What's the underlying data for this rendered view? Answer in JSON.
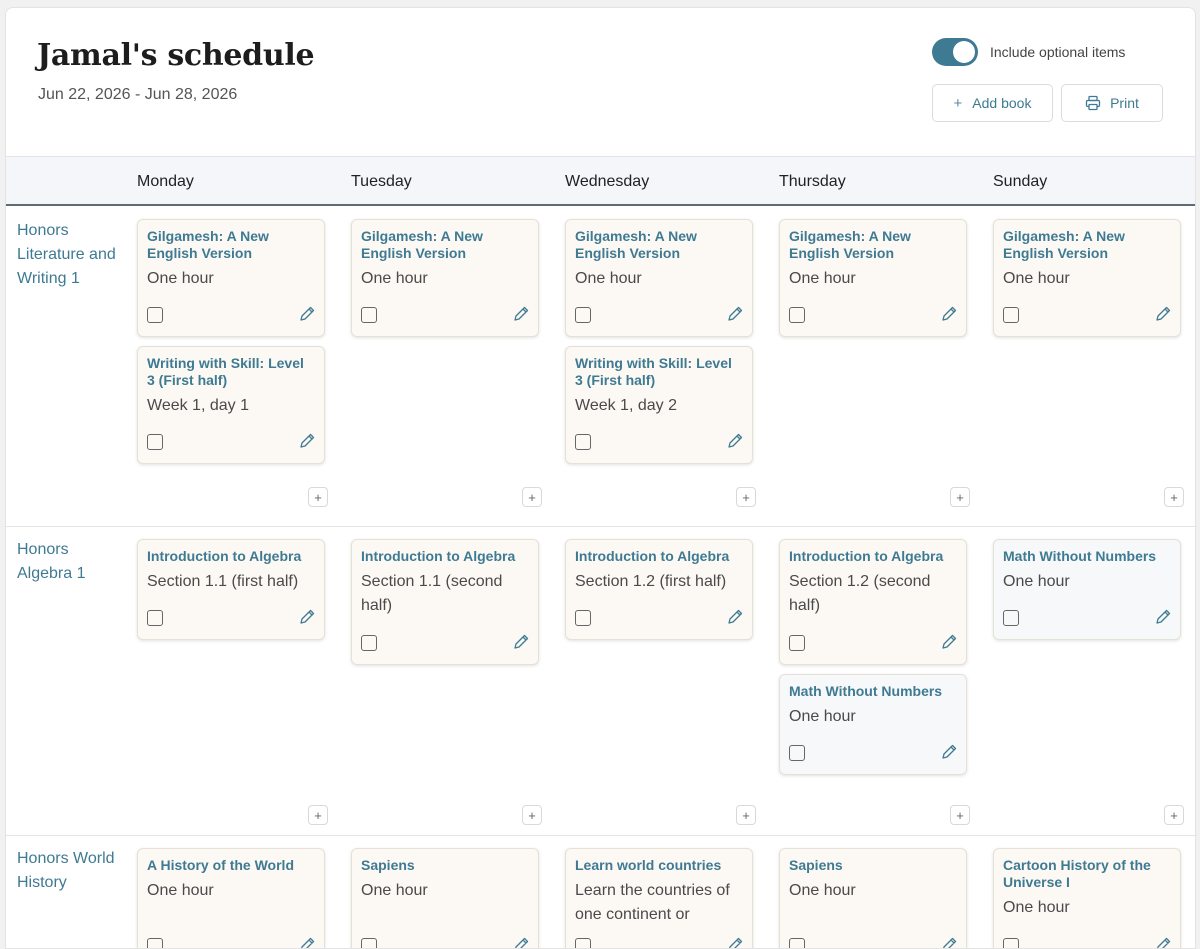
{
  "header": {
    "title": "Jamal's schedule",
    "date_range": "Jun 22, 2026 - Jun 28, 2026",
    "toggle_label": "Include optional items",
    "toggle_on": true,
    "add_book_label": "Add book",
    "print_label": "Print"
  },
  "days": [
    "Monday",
    "Tuesday",
    "Wednesday",
    "Thursday",
    "Sunday"
  ],
  "colors": {
    "accent": "#3f7a93",
    "card_bg": "#fcf9f4",
    "optional_card_bg": "#f7f8f9"
  },
  "rows": [
    {
      "subject": "Honors Literature and Writing 1",
      "cells": [
        [
          {
            "title": "Gilgamesh: A New English Version",
            "desc": "One hour"
          },
          {
            "title": "Writing with Skill: Level 3 (First half)",
            "desc": "Week 1, day 1"
          }
        ],
        [
          {
            "title": "Gilgamesh: A New English Version",
            "desc": "One hour"
          }
        ],
        [
          {
            "title": "Gilgamesh: A New English Version",
            "desc": "One hour"
          },
          {
            "title": "Writing with Skill: Level 3 (First half)",
            "desc": "Week 1, day 2"
          }
        ],
        [
          {
            "title": "Gilgamesh: A New English Version",
            "desc": "One hour"
          }
        ],
        [
          {
            "title": "Gilgamesh: A New English Version",
            "desc": "One hour"
          }
        ]
      ]
    },
    {
      "subject": "Honors Algebra 1",
      "cells": [
        [
          {
            "title": "Introduction to Algebra",
            "desc": "Section 1.1 (first half)"
          }
        ],
        [
          {
            "title": "Introduction to Algebra",
            "desc": "Section 1.1 (second half)"
          }
        ],
        [
          {
            "title": "Introduction to Algebra",
            "desc": "Section 1.2 (first half)"
          }
        ],
        [
          {
            "title": "Introduction to Algebra",
            "desc": "Section 1.2 (second half)"
          },
          {
            "title": "Math Without Numbers",
            "desc": "One hour",
            "optional": true
          }
        ],
        [
          {
            "title": "Math Without Numbers",
            "desc": "One hour",
            "optional": true
          }
        ]
      ]
    },
    {
      "subject": "Honors World History",
      "cells": [
        [
          {
            "title": "A History of the World",
            "desc": "One hour"
          }
        ],
        [
          {
            "title": "Sapiens",
            "desc": "One hour"
          }
        ],
        [
          {
            "title": "Learn world countries",
            "desc": "Learn the countries of one continent or"
          }
        ],
        [
          {
            "title": "Sapiens",
            "desc": "One hour"
          }
        ],
        [
          {
            "title": "Cartoon History of the Universe I",
            "desc": "One hour"
          }
        ]
      ]
    }
  ]
}
